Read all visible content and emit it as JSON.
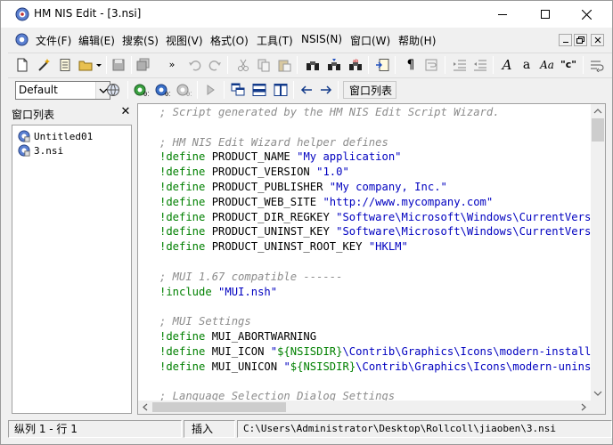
{
  "window": {
    "title": "HM NIS Edit - [3.nsi]"
  },
  "menubar": {
    "items": [
      "文件(F)",
      "编辑(E)",
      "搜索(S)",
      "视图(V)",
      "格式(O)",
      "工具(T)",
      "NSIS(N)",
      "窗口(W)",
      "帮助(H)"
    ]
  },
  "toolbar2": {
    "combo_value": "Default",
    "window_list_button": "窗口列表"
  },
  "side_panel": {
    "title": "窗口列表",
    "items": [
      "Untitled01",
      "3.nsi"
    ]
  },
  "editor": {
    "lines": [
      {
        "t": "c",
        "text": "; Script generated by the HM NIS Edit Script Wizard."
      },
      {
        "t": "b",
        "text": ""
      },
      {
        "t": "c",
        "text": "; HM NIS Edit Wizard helper defines"
      },
      {
        "t": "d",
        "kw": "!define",
        "name": " PRODUCT_NAME ",
        "val": "\"My application\""
      },
      {
        "t": "d",
        "kw": "!define",
        "name": " PRODUCT_VERSION ",
        "val": "\"1.0\""
      },
      {
        "t": "d",
        "kw": "!define",
        "name": " PRODUCT_PUBLISHER ",
        "val": "\"My company, Inc.\""
      },
      {
        "t": "d",
        "kw": "!define",
        "name": " PRODUCT_WEB_SITE ",
        "val": "\"http://www.mycompany.com\""
      },
      {
        "t": "d",
        "kw": "!define",
        "name": " PRODUCT_DIR_REGKEY ",
        "val": "\"Software\\Microsoft\\Windows\\CurrentVersion\\App Paths\\makensis.exe\""
      },
      {
        "t": "d",
        "kw": "!define",
        "name": " PRODUCT_UNINST_KEY ",
        "val": "\"Software\\Microsoft\\Windows\\CurrentVersion\\Uninstall\\${PRODUCT_NAME}\""
      },
      {
        "t": "d",
        "kw": "!define",
        "name": " PRODUCT_UNINST_ROOT_KEY ",
        "val": "\"HKLM\""
      },
      {
        "t": "b",
        "text": ""
      },
      {
        "t": "c",
        "text": "; MUI 1.67 compatible ------"
      },
      {
        "t": "d",
        "kw": "!include",
        "name": " ",
        "val": "\"MUI.nsh\""
      },
      {
        "t": "b",
        "text": ""
      },
      {
        "t": "c",
        "text": "; MUI Settings"
      },
      {
        "t": "d",
        "kw": "!define",
        "name": " MUI_ABORTWARNING",
        "val": ""
      },
      {
        "t": "i",
        "kw": "!define",
        "name": " MUI_ICON ",
        "q": "\"",
        "var": "${NSISDIR}",
        "rest": "\\Contrib\\Graphics\\Icons\\modern-install.ico\""
      },
      {
        "t": "i",
        "kw": "!define",
        "name": " MUI_UNICON ",
        "q": "\"",
        "var": "${NSISDIR}",
        "rest": "\\Contrib\\Graphics\\Icons\\modern-uninstall.ico\""
      },
      {
        "t": "b",
        "text": ""
      },
      {
        "t": "c",
        "text": "; Language Selection Dialog Settings"
      }
    ]
  },
  "statusbar": {
    "position": "纵列 1 - 行 1",
    "mode": "插入",
    "path": "C:\\Users\\Administrator\\Desktop\\Rollcoll\\jiaoben\\3.nsi"
  },
  "colors": {
    "comment": "#8c8c8c",
    "keyword": "#008000",
    "string": "#0000c0"
  }
}
